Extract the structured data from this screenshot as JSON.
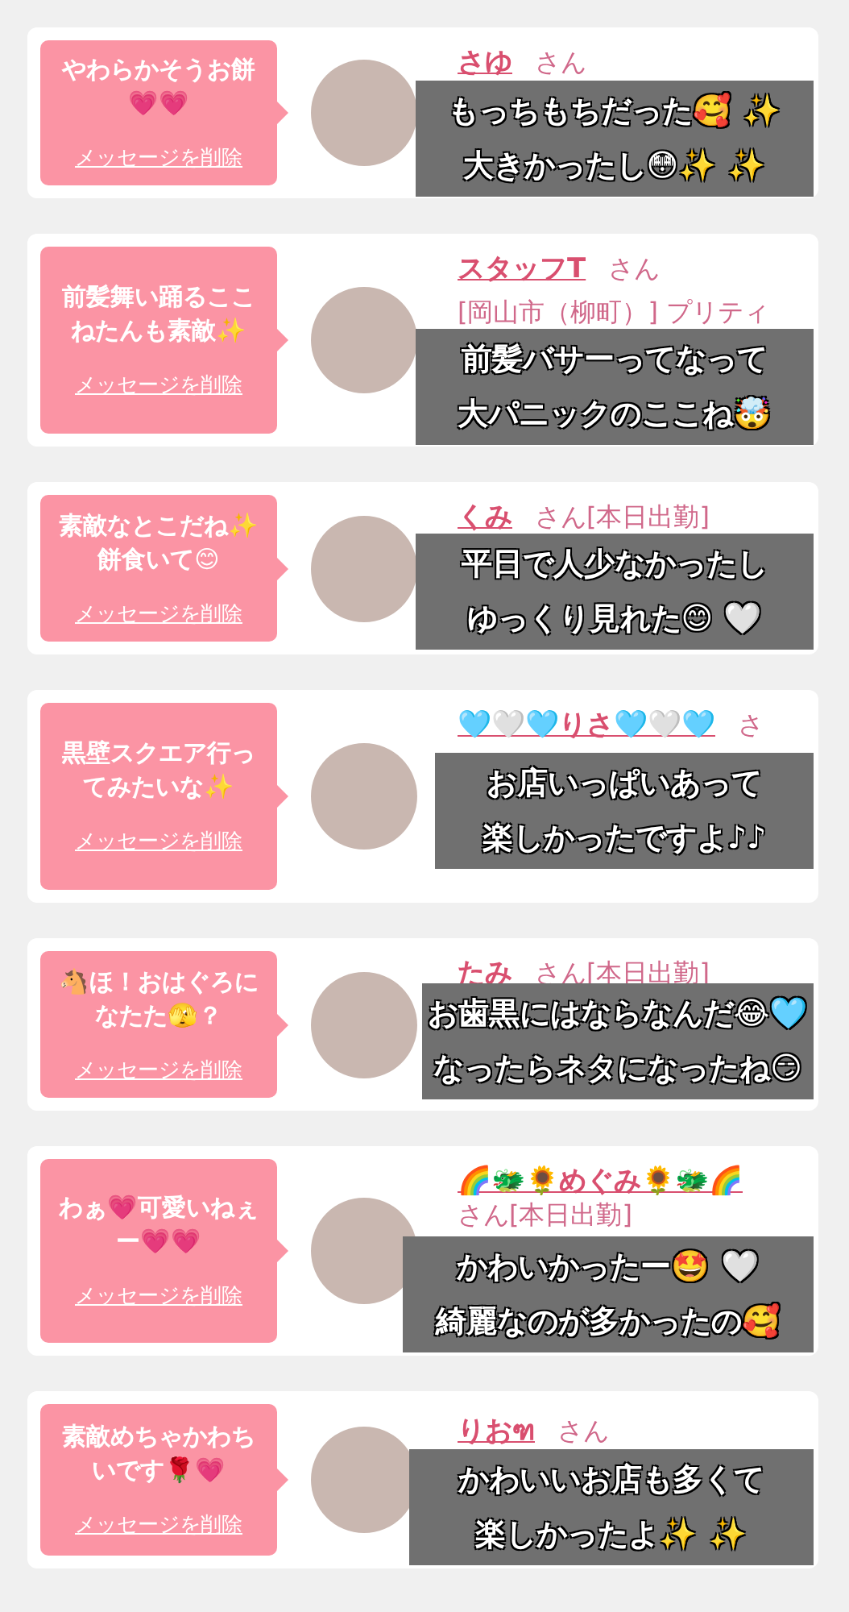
{
  "messages": [
    {
      "message": "やわらかそうお餅💗💗",
      "delete_link": "メッセージを削除",
      "name": "さゆ",
      "honorific": "さん",
      "caption": [
        "もっちもちだった🥰 ✨",
        "大きかったし😳✨ ✨"
      ]
    },
    {
      "message": "前髪舞い踊るここねたんも素敵✨",
      "delete_link": "メッセージを削除",
      "name": "スタッフT",
      "honorific": "さん",
      "shop": "[岡山市（柳町）] プリティ",
      "caption": [
        "前髪バサーってなって",
        "大パニックのここね🤯"
      ]
    },
    {
      "message": "素敵なとこだね✨餅食いて😊",
      "delete_link": "メッセージを削除",
      "name": "くみ",
      "honorific": "さん",
      "status": "[本日出勤]",
      "caption": [
        "平日で人少なかったし",
        "ゆっくり見れた😊 🤍"
      ]
    },
    {
      "message": "黒壁スクエア行ってみたいな✨",
      "delete_link": "メッセージを削除",
      "name": "🩵🤍🩵りさ🩵🤍🩵",
      "honorific": "さ",
      "caption": [
        "お店いっぱいあって",
        "楽しかったですよ♪♪"
      ]
    },
    {
      "message": "🐴ほ！おはぐろになたた🫣？",
      "delete_link": "メッセージを削除",
      "name": "たみ",
      "honorific": "さん",
      "status": "[本日出勤]",
      "caption": [
        "お歯黒にはならなんだ😂🩵",
        "なったらネタになったね😏"
      ]
    },
    {
      "message": "わぁ💗可愛いねぇー💗💗",
      "delete_link": "メッセージを削除",
      "name": "🌈🐲🌻めぐみ🌻🐲🌈",
      "honorific": "さん",
      "status": "[本日出勤]",
      "caption": [
        "かわいかったー🤩 🤍",
        "綺麗なのが多かったの🥰"
      ]
    },
    {
      "message": "素敵めちゃかわちいです🌹💗",
      "delete_link": "メッセージを削除",
      "name": "りおฑ",
      "honorific": "さん",
      "caption": [
        "かわいいお店も多くて",
        "楽しかったよ✨ ✨"
      ]
    }
  ]
}
